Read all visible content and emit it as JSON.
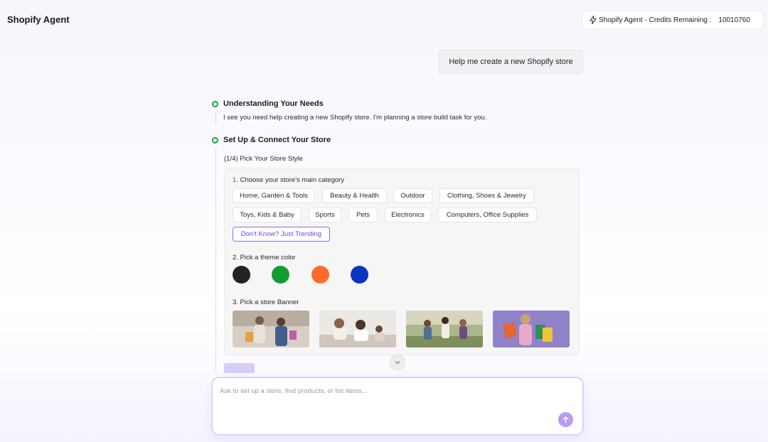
{
  "app": {
    "title": "Shopify Agent"
  },
  "credits": {
    "label": "Shopify Agent - Credits Remaining :",
    "count": "10010760",
    "icon": "lightning-icon"
  },
  "chat": {
    "user_message": "Help me create a new Shopify store"
  },
  "steps": [
    {
      "title": "Understanding Your Needs",
      "text": "I see you need help creating a new Shopify store. I'm planning a store build task for you."
    },
    {
      "title": "Set Up & Connect Your Store",
      "text": "(1/4) Pick Your Store Style"
    }
  ],
  "store_style": {
    "category_prefix": "1.",
    "category_label": " Choose your store's main category",
    "categories": [
      "Home, Garden & Tools",
      "Beauty & Health",
      "Outdoor",
      "Clothing, Shoes & Jewelry",
      "Toys, Kids & Baby",
      "Sports",
      "Pets",
      "Electronics",
      "Computers, Office Supplies",
      "Don't Know? Just Trending"
    ],
    "color_label": "2. Pick a theme color",
    "colors": [
      "#222222",
      "#0f9d32",
      "#ff6a2b",
      "#0a35c2"
    ],
    "banner_label": "3. Pick a store Banner",
    "banners": [
      "shopping-couple-banner",
      "family-home-banner",
      "friends-outdoor-banner",
      "shopping-bags-purple-banner"
    ]
  },
  "input": {
    "placeholder": "Ask to set up a store, find products, or list items..."
  },
  "theme": {
    "accent": "#8b6cf0",
    "step_green": "#16a34a",
    "send_button": "#b99af5"
  }
}
